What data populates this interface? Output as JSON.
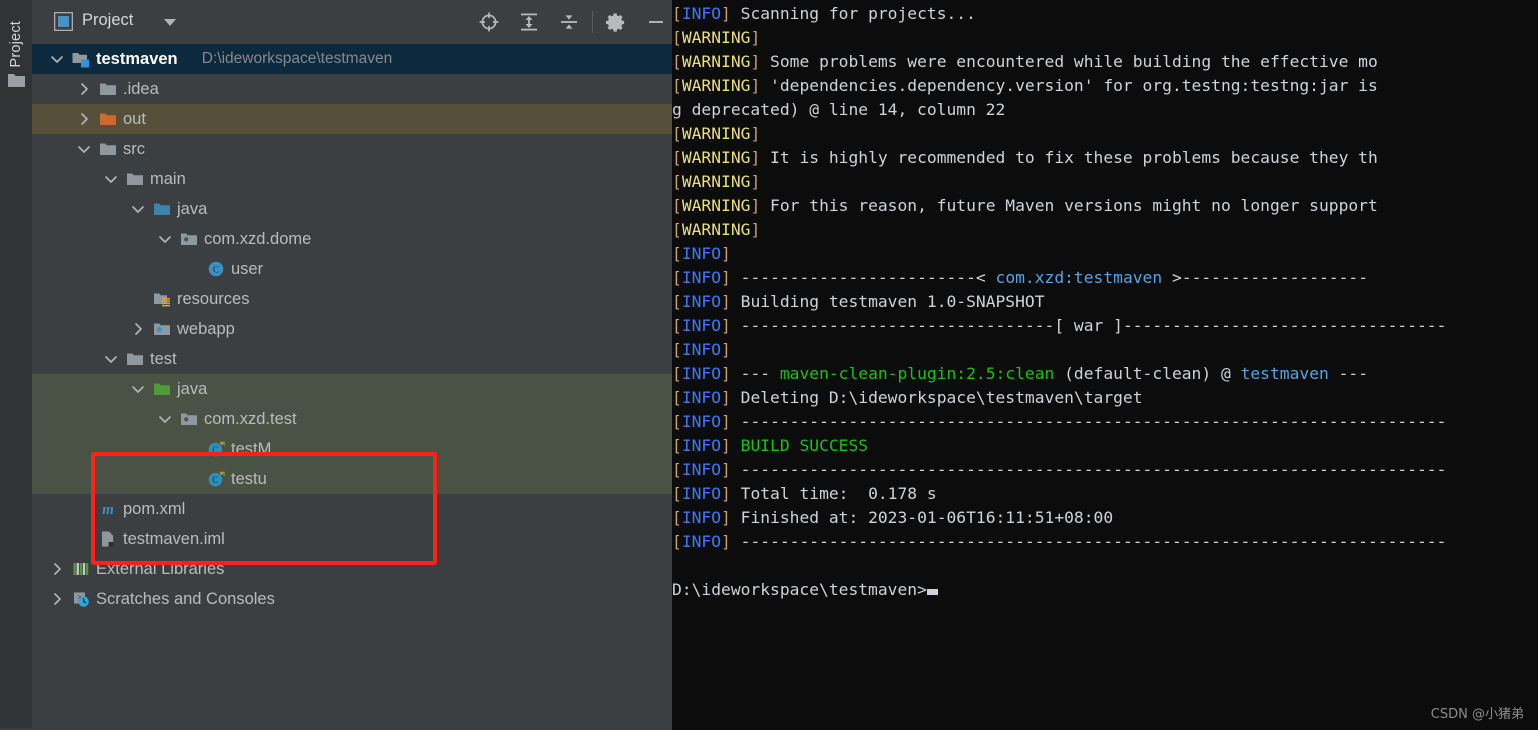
{
  "toolwindow": {
    "vertical_tab_label": "Project",
    "strip_icon": "folder-icon"
  },
  "panel_header": {
    "icon": "project-view-icon",
    "title": "Project",
    "caret_icon": "chevron-down-icon",
    "tools": [
      {
        "name": "select-opened-file-icon",
        "label": "Select Opened File"
      },
      {
        "name": "expand-all-icon",
        "label": "Expand All"
      },
      {
        "name": "collapse-all-icon",
        "label": "Collapse All"
      },
      {
        "name": "settings-gear-icon",
        "label": "Settings"
      },
      {
        "name": "hide-icon",
        "label": "Hide"
      }
    ]
  },
  "tree": {
    "rows": [
      {
        "label": "testmaven",
        "sub": "D:\\ideworkspace\\testmaven",
        "depth": 0,
        "arrow": "down",
        "icon": "module-icon",
        "state": "selected",
        "name": "tree-row-testmaven"
      },
      {
        "label": ".idea",
        "sub": "",
        "depth": 1,
        "arrow": "right",
        "icon": "folder-icon",
        "state": "normal",
        "name": "tree-row-idea"
      },
      {
        "label": "out",
        "sub": "",
        "depth": 1,
        "arrow": "right",
        "icon": "folder-excluded-icon",
        "state": "excluded",
        "name": "tree-row-out"
      },
      {
        "label": "src",
        "sub": "",
        "depth": 1,
        "arrow": "down",
        "icon": "folder-icon",
        "state": "normal",
        "name": "tree-row-src"
      },
      {
        "label": "main",
        "sub": "",
        "depth": 2,
        "arrow": "down",
        "icon": "folder-icon",
        "state": "normal",
        "name": "tree-row-main"
      },
      {
        "label": "java",
        "sub": "",
        "depth": 3,
        "arrow": "down",
        "icon": "folder-sources-icon",
        "state": "normal",
        "name": "tree-row-main-java"
      },
      {
        "label": "com.xzd.dome",
        "sub": "",
        "depth": 4,
        "arrow": "down",
        "icon": "package-icon",
        "state": "normal",
        "name": "tree-row-package-comxzddome"
      },
      {
        "label": "user",
        "sub": "",
        "depth": 5,
        "arrow": "none",
        "icon": "java-class-icon",
        "state": "normal",
        "name": "tree-row-class-user"
      },
      {
        "label": "resources",
        "sub": "",
        "depth": 3,
        "arrow": "none",
        "icon": "folder-resources-icon",
        "state": "normal",
        "name": "tree-row-resources"
      },
      {
        "label": "webapp",
        "sub": "",
        "depth": 3,
        "arrow": "right",
        "icon": "folder-webapp-icon",
        "state": "normal",
        "name": "tree-row-webapp"
      },
      {
        "label": "test",
        "sub": "",
        "depth": 2,
        "arrow": "down",
        "icon": "folder-icon",
        "state": "normal",
        "name": "tree-row-test"
      },
      {
        "label": "java",
        "sub": "",
        "depth": 3,
        "arrow": "down",
        "icon": "folder-test-sources-icon",
        "state": "testsrc",
        "name": "tree-row-test-java"
      },
      {
        "label": "com.xzd.test",
        "sub": "",
        "depth": 4,
        "arrow": "down",
        "icon": "package-icon",
        "state": "testsrc",
        "name": "tree-row-package-comxzdtest"
      },
      {
        "label": "testM",
        "sub": "",
        "depth": 5,
        "arrow": "none",
        "icon": "java-test-class-icon",
        "state": "testsrc",
        "name": "tree-row-class-testm"
      },
      {
        "label": "testu",
        "sub": "",
        "depth": 5,
        "arrow": "none",
        "icon": "java-test-class-icon",
        "state": "testsrc",
        "name": "tree-row-class-testu"
      },
      {
        "label": "pom.xml",
        "sub": "",
        "depth": 1,
        "arrow": "none",
        "icon": "maven-pom-icon",
        "state": "normal",
        "name": "tree-row-pom-xml"
      },
      {
        "label": "testmaven.iml",
        "sub": "",
        "depth": 1,
        "arrow": "none",
        "icon": "iml-module-file-icon",
        "state": "normal",
        "name": "tree-row-testmaven-iml"
      },
      {
        "label": "External Libraries",
        "sub": "",
        "depth": 0,
        "arrow": "right",
        "icon": "libraries-icon",
        "state": "normal",
        "name": "tree-row-external-libraries"
      },
      {
        "label": "Scratches and Consoles",
        "sub": "",
        "depth": 0,
        "arrow": "right",
        "icon": "scratches-icon",
        "state": "normal",
        "name": "tree-row-scratches-and-consoles"
      }
    ]
  },
  "annotation": {
    "highlight_color": "#ff2116",
    "name": "red-highlight-box"
  },
  "console": {
    "lines": [
      {
        "tag": "INFO",
        "text": " Scanning for projects..."
      },
      {
        "tag": "WARNING",
        "text": ""
      },
      {
        "tag": "WARNING",
        "text": " Some problems were encountered while building the effective mo"
      },
      {
        "tag": "WARNING",
        "text": " 'dependencies.dependency.version' for org.testng:testng:jar is"
      },
      {
        "tag": "",
        "text": "g deprecated) @ line 14, column 22"
      },
      {
        "tag": "WARNING",
        "text": ""
      },
      {
        "tag": "WARNING",
        "text": " It is highly recommended to fix these problems because they th"
      },
      {
        "tag": "WARNING",
        "text": ""
      },
      {
        "tag": "WARNING",
        "text": " For this reason, future Maven versions might no longer support"
      },
      {
        "tag": "WARNING",
        "text": ""
      },
      {
        "tag": "INFO",
        "text": ""
      },
      {
        "tag": "INFO",
        "parts": [
          {
            "t": " ------------------------< ",
            "c": "plain"
          },
          {
            "t": "com.xzd:testmaven",
            "c": "cyan"
          },
          {
            "t": " >-------------------",
            "c": "plain"
          }
        ]
      },
      {
        "tag": "INFO",
        "text": " Building testmaven 1.0-SNAPSHOT"
      },
      {
        "tag": "INFO",
        "text": " --------------------------------[ war ]---------------------------------"
      },
      {
        "tag": "INFO",
        "text": ""
      },
      {
        "tag": "INFO",
        "parts": [
          {
            "t": " --- ",
            "c": "plain"
          },
          {
            "t": "maven-clean-plugin:2.5:clean",
            "c": "green"
          },
          {
            "t": " (default-clean) @ ",
            "c": "plain"
          },
          {
            "t": "testmaven",
            "c": "cyan"
          },
          {
            "t": " ---",
            "c": "plain"
          }
        ]
      },
      {
        "tag": "INFO",
        "text": " Deleting D:\\ideworkspace\\testmaven\\target"
      },
      {
        "tag": "INFO",
        "text": " ------------------------------------------------------------------------"
      },
      {
        "tag": "INFO",
        "parts": [
          {
            "t": " ",
            "c": "plain"
          },
          {
            "t": "BUILD SUCCESS",
            "c": "green"
          }
        ]
      },
      {
        "tag": "INFO",
        "text": " ------------------------------------------------------------------------"
      },
      {
        "tag": "INFO",
        "text": " Total time:  0.178 s"
      },
      {
        "tag": "INFO",
        "text": " Finished at: 2023-01-06T16:11:51+08:00"
      },
      {
        "tag": "INFO",
        "text": " ------------------------------------------------------------------------"
      },
      {
        "tag": "",
        "text": ""
      },
      {
        "tag": "",
        "text": "D:\\ideworkspace\\testmaven>",
        "cursor": true
      }
    ],
    "colors": {
      "info": "#3b78ff",
      "warning": "#e9e07a",
      "success": "#16c60c",
      "artifact": "#4fa6e8",
      "background": "#0c0c0c"
    }
  },
  "watermark": {
    "text": "CSDN @小猪弟"
  }
}
